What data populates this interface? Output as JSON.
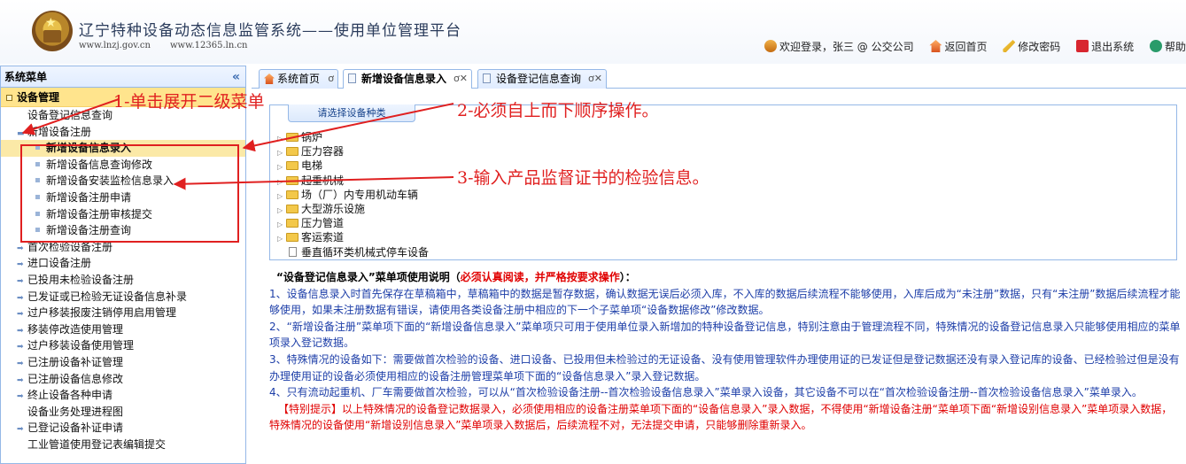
{
  "header": {
    "title": "辽宁特种设备动态信息监管系统——使用单位管理平台",
    "url1": "www.lnzj.gov.cn",
    "url2": "www.12365.ln.cn",
    "welcome": "欢迎登录，张三 @ 公交公司",
    "home_label": "返回首页",
    "change_pwd_label": "修改密码",
    "logout_label": "退出系统",
    "help_label": "帮助"
  },
  "sidebar": {
    "title": "系统菜单",
    "collapse": "«",
    "group": "设备管理",
    "items": [
      {
        "label": "设备登记信息查询"
      },
      {
        "label": "新增设备注册"
      },
      {
        "label": "新增设备信息录入"
      },
      {
        "label": "新增设备信息查询修改"
      },
      {
        "label": "新增设备安装监检信息录入"
      },
      {
        "label": "新增设备注册申请"
      },
      {
        "label": "新增设备注册审核提交"
      },
      {
        "label": "新增设备注册查询"
      },
      {
        "label": "首次检验设备注册"
      },
      {
        "label": "进口设备注册"
      },
      {
        "label": "已投用未检验设备注册"
      },
      {
        "label": "已发证或已检验无证设备信息补录"
      },
      {
        "label": "过户移装报废注销停用启用管理"
      },
      {
        "label": "移装停改造使用管理"
      },
      {
        "label": "过户移装设备使用管理"
      },
      {
        "label": "已注册设备补证管理"
      },
      {
        "label": "已注册设备信息修改"
      },
      {
        "label": "终止设备各种申请"
      },
      {
        "label": "设备业务处理进程图"
      },
      {
        "label": "已登记设备补证申请"
      },
      {
        "label": "工业管道使用登记表编辑提交"
      }
    ]
  },
  "tabs": [
    {
      "label": "系统首页",
      "close": "ơ"
    },
    {
      "label": "新增设备信息录入",
      "close": "ơ✕"
    },
    {
      "label": "设备登记信息查询",
      "close": "ơ✕"
    }
  ],
  "type_panel": {
    "header": "请选择设备种类",
    "types": [
      "锅炉",
      "压力容器",
      "电梯",
      "起重机械",
      "场（厂）内专用机动车辆",
      "大型游乐设施",
      "压力管道",
      "客运索道",
      "垂直循环类机械式停车设备"
    ]
  },
  "instructions": {
    "title": "“设备登记信息录入”菜单项使用说明（",
    "title_warn": "必须认真阅读，并严格按要求操作",
    "title_end": "）：",
    "p1": "1、设备信息录入时首先保存在草稿箱中，草稿箱中的数据是暂存数据，确认数据无误后必须入库，不入库的数据后续流程不能够使用，入库后成为“未注册”数据，只有“未注册”数据后续流程才能够使用，如果未注册数据有错误，请使用各类设备注册中相应的下一个子菜单项“设备数据修改”修改数据。",
    "p2": "2、“新增设备注册”菜单项下面的“新增设备信息录入”菜单项只可用于使用单位录入新增加的特种设备登记信息，特别注意由于管理流程不同，特殊情况的设备登记信息录入只能够使用相应的菜单项录入登记数据。",
    "p3": "3、特殊情况的设备如下：需要做首次检验的设备、进口设备、已投用但未检验过的无证设备、没有使用管理软件办理使用证的已发证但是登记数据还没有录入登记库的设备、已经检验过但是没有办理使用证的设备必须使用相应的设备注册管理菜单项下面的“设备信息录入”录入登记数据。",
    "p4": "4、只有流动起重机、厂车需要做首次检验，可以从“首次检验设备注册--首次检验设备信息录入”菜单录入设备，其它设备不可以在“首次检验设备注册--首次检验设备信息录入”菜单录入。",
    "special": "【特别提示】以上特殊情况的设备登记数据录入，必须使用相应的设备注册菜单项下面的“设备信息录入”录入数据，不得使用“新增设备注册“菜单项下面“新增设别信息录入”菜单项录入数据，特殊情况的设备使用“新增设别信息录入”菜单项录入数据后，后续流程不对，无法提交申请，只能够删除重新录入。"
  },
  "annotations": {
    "a1": "1-单击展开二级菜单",
    "a2": "2-必须自上而下顺序操作。",
    "a3": "3-输入产品监督证书的检验信息。"
  },
  "colors": {
    "annotation_red": "#e02020",
    "instruction_blue": "#1d3ea8",
    "selected_bg": "#fbe9a7",
    "border_blue": "#95b8e7"
  }
}
